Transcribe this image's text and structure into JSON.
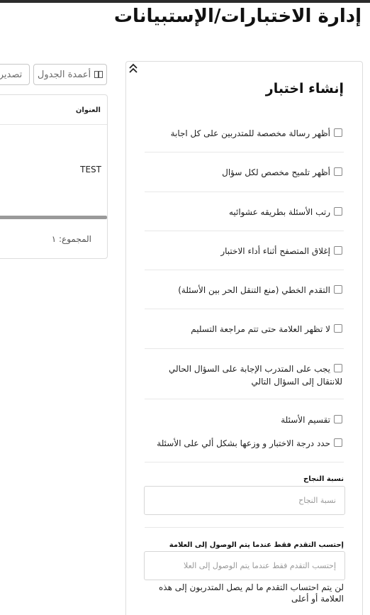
{
  "page": {
    "title": "إدارة الاختبارات/الإستبيانات"
  },
  "toolbar": {
    "columns_label": "أعمدة الجدول",
    "export_label": "تصدير"
  },
  "table": {
    "header_title": "العنوان",
    "rows": [
      {
        "title": "TEST"
      }
    ],
    "total_label": "المجموع: ١"
  },
  "panel": {
    "heading": "إنشاء اختبار",
    "options": [
      {
        "label": "أظهر رسالة مخصصة للمتدربين على كل اجابة",
        "checked": false
      },
      {
        "label": "أظهر تلميح مخصص لكل سؤال",
        "checked": false
      },
      {
        "label": "رتب الأسئلة بطريقه عشوائيه",
        "checked": false
      },
      {
        "label": "إغلاق المتصفح أثناء أداء الاختبار",
        "checked": false
      },
      {
        "label": "التقدم الخطي (منع التنقل الحر بين الأسئلة)",
        "checked": false
      },
      {
        "label": "لا تظهر العلامة حتى تتم مراجعة التسليم",
        "checked": false
      },
      {
        "label": "يجب على المتدرب الإجابة على السؤال الحالي للانتقال إلى السؤال التالي",
        "checked": false
      },
      {
        "label": "تقسيم الأسئلة",
        "checked": false
      },
      {
        "label": "حدد درجة الاختبار و وزعها بشكل ألي على الأسئلة",
        "checked": false
      }
    ],
    "pass_rate": {
      "label": "نسبة النجاح",
      "placeholder": "نسبة النجاح",
      "value": ""
    },
    "progress_threshold": {
      "label": "إحتسب التقدم فقط عندما يتم الوصول إلى العلامة",
      "placeholder": "إحتسب التقدم فقط عندما يتم الوصول إلى العلا",
      "value": "",
      "help": "لن يتم احتساب التقدم ما لم يصل المتدربون إلى هذه العلامة أو أعلى"
    }
  }
}
